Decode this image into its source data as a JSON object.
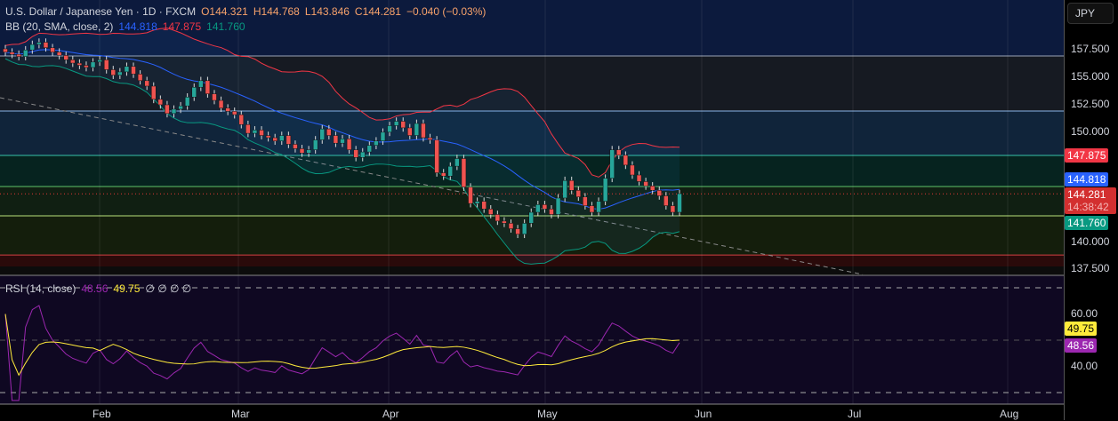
{
  "header": {
    "symbol": "U.S. Dollar / Japanese Yen · 1D · FXCM",
    "o": "O144.321",
    "h": "H144.768",
    "l": "L143.846",
    "c": "C144.281",
    "chg": "−0.040 (−0.03%)"
  },
  "bb": {
    "label": "BB (20, SMA, close, 2)",
    "basis": "144.818",
    "upper": "147.875",
    "lower": "141.760"
  },
  "rsi": {
    "label": "RSI (14, close)",
    "value": "48.56",
    "ma": "49.75",
    "extra": "∅ ∅ ∅ ∅"
  },
  "currency": "JPY",
  "price_ticks": [
    "157.500",
    "155.000",
    "152.500",
    "150.000",
    "140.000",
    "137.500"
  ],
  "rsi_ticks": [
    "60.00",
    "40.00"
  ],
  "last_price": "144.281",
  "countdown": "14:38:42",
  "x_labels": [
    "Feb",
    "Mar",
    "Apr",
    "May",
    "Jun",
    "Jul",
    "Aug"
  ],
  "colors": {
    "up": "#26a69a",
    "down": "#ef5350",
    "upper": "#f23645",
    "basis": "#2962ff",
    "lower": "#089981",
    "rsi": "#9c27b0",
    "rsima": "#ffeb3b"
  },
  "chart_data": {
    "type": "candlestick",
    "levels": [
      156.85,
      151.83,
      147.78,
      144.95,
      142.28,
      138.7
    ],
    "closes": [
      157.2,
      157.0,
      156.8,
      157.4,
      157.9,
      158.1,
      157.6,
      157.2,
      156.9,
      156.5,
      156.2,
      156.0,
      155.8,
      156.3,
      156.5,
      155.6,
      155.1,
      155.4,
      155.9,
      155.2,
      154.6,
      154.1,
      152.9,
      152.4,
      151.6,
      152.0,
      152.3,
      153.1,
      154.0,
      154.6,
      153.4,
      152.8,
      152.1,
      151.8,
      151.5,
      150.6,
      149.8,
      150.1,
      149.6,
      149.4,
      149.1,
      149.6,
      148.8,
      148.4,
      148.0,
      148.3,
      149.2,
      150.2,
      149.6,
      148.9,
      149.3,
      148.3,
      147.6,
      148.1,
      148.7,
      149.1,
      149.9,
      150.5,
      150.9,
      150.3,
      149.6,
      150.7,
      149.4,
      149.2,
      146.2,
      145.9,
      146.8,
      147.5,
      144.9,
      143.4,
      143.6,
      142.9,
      142.4,
      141.8,
      141.6,
      141.1,
      140.6,
      141.6,
      142.6,
      143.3,
      142.9,
      142.4,
      143.9,
      145.5,
      144.6,
      144.0,
      143.2,
      142.6,
      143.6,
      145.7,
      148.3,
      147.8,
      146.9,
      146.0,
      145.4,
      145.0,
      144.6,
      144.1,
      143.2,
      142.6,
      144.3
    ]
  }
}
